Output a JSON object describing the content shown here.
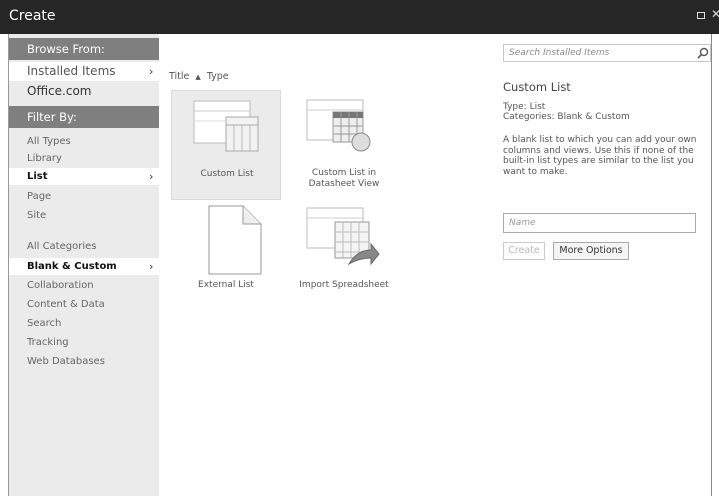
{
  "window": {
    "title": "Create"
  },
  "sidebar": {
    "browse_header": "Browse From:",
    "sources": [
      {
        "label": "Installed Items",
        "selected": true
      },
      {
        "label": "Office.com",
        "selected": false
      }
    ],
    "filter_header": "Filter By:",
    "types": [
      {
        "label": "All Types",
        "selected": false
      },
      {
        "label": "Library",
        "selected": false
      },
      {
        "label": "List",
        "selected": true
      },
      {
        "label": "Page",
        "selected": false
      },
      {
        "label": "Site",
        "selected": false
      }
    ],
    "categories": [
      {
        "label": "All Categories",
        "selected": false
      },
      {
        "label": "Blank & Custom",
        "selected": true
      },
      {
        "label": "Collaboration",
        "selected": false
      },
      {
        "label": "Content & Data",
        "selected": false
      },
      {
        "label": "Search",
        "selected": false
      },
      {
        "label": "Tracking",
        "selected": false
      },
      {
        "label": "Web Databases",
        "selected": false
      }
    ],
    "chevron": "›"
  },
  "sortbar": {
    "title": "Title",
    "arrow": "▲",
    "type": "Type"
  },
  "templates": [
    {
      "label": "Custom List",
      "icon": "custom-list-icon"
    },
    {
      "label": "Custom List in Datasheet View",
      "icon": "datasheet-list-icon"
    },
    {
      "label": "External List",
      "icon": "external-list-icon"
    },
    {
      "label": "Import Spreadsheet",
      "icon": "import-spreadsheet-icon"
    }
  ],
  "search": {
    "placeholder": "Search Installed Items"
  },
  "details": {
    "title": "Custom List",
    "type_line": "Type: List",
    "categories_line": "Categories: Blank & Custom",
    "description": "A blank list to which you can add your own columns and views. Use this if none of the built-in list types are similar to the list you want to make."
  },
  "name_field": {
    "placeholder": "Name"
  },
  "buttons": {
    "create": "Create",
    "more_options": "More Options"
  }
}
